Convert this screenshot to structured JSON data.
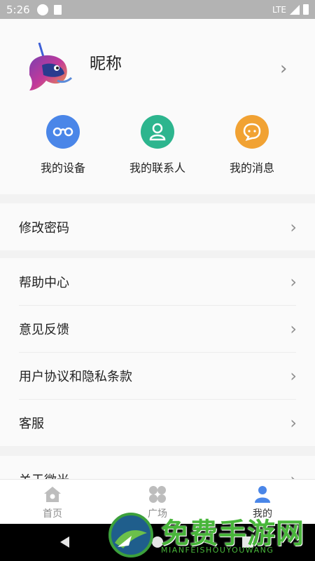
{
  "status_bar": {
    "time": "5:26",
    "network": "LTE"
  },
  "profile": {
    "nickname": "昵称"
  },
  "quick_actions": [
    {
      "label": "我的设备",
      "icon": "glasses-icon",
      "color": "#4a86e8"
    },
    {
      "label": "我的联系人",
      "icon": "contact-icon",
      "color": "#2db58e"
    },
    {
      "label": "我的消息",
      "icon": "chat-bubble-icon",
      "color": "#f1a233"
    }
  ],
  "menu_groups": [
    {
      "items": [
        {
          "label": "修改密码"
        }
      ]
    },
    {
      "items": [
        {
          "label": "帮助中心"
        },
        {
          "label": "意见反馈"
        },
        {
          "label": "用户协议和隐私条款"
        },
        {
          "label": "客服"
        }
      ]
    },
    {
      "items": [
        {
          "label": "关于微光"
        }
      ]
    }
  ],
  "tabbar": [
    {
      "label": "首页",
      "icon": "home-icon",
      "active": false
    },
    {
      "label": "广场",
      "icon": "clover-icon",
      "active": false
    },
    {
      "label": "我的",
      "icon": "person-icon",
      "active": true
    }
  ],
  "watermark": {
    "text": "免费手游网",
    "subtext": "MIANFEISHOUYOUWANG"
  },
  "colors": {
    "accent_blue": "#4a86e8",
    "green": "#2db58e",
    "orange": "#f1a233"
  }
}
